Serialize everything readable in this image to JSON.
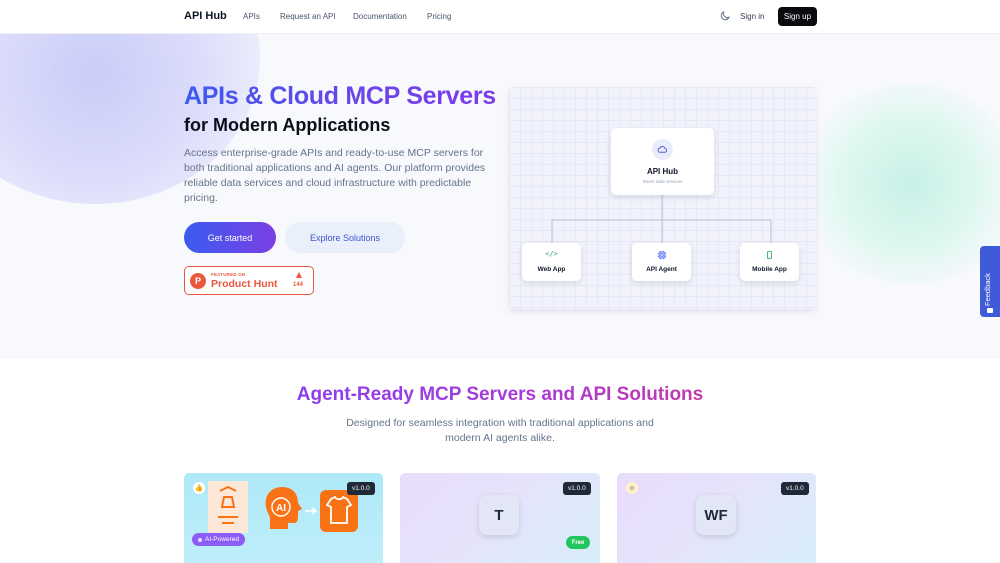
{
  "nav": {
    "brand": "API Hub",
    "links": [
      "APIs",
      "Request an API",
      "Documentation",
      "Pricing"
    ],
    "signin": "Sign in",
    "signup": "Sign up"
  },
  "hero": {
    "title_line1": "APIs & Cloud MCP Servers",
    "title_line2": "for Modern Applications",
    "description": "Access enterprise-grade APIs and ready-to-use MCP servers for both traditional applications and AI agents. Our platform provides reliable data services and cloud infrastructure with predictable pricing.",
    "primary_button": "Get started",
    "secondary_button": "Explore Solutions",
    "product_hunt": {
      "logo_letter": "P",
      "featured": "FEATURED ON",
      "name": "Product Hunt",
      "votes": "144"
    }
  },
  "diagram": {
    "hub_title": "API Hub",
    "hub_subtitle": "Smart data services",
    "nodes": [
      {
        "label": "Web App",
        "icon": "code-icon"
      },
      {
        "label": "API Agent",
        "icon": "chip-icon"
      },
      {
        "label": "Mobile App",
        "icon": "phone-icon"
      }
    ]
  },
  "feedback": "Feedback",
  "section": {
    "title": "Agent-Ready MCP Servers and API Solutions",
    "subtitle": "Designed for seamless integration with traditional applications and modern AI agents alike."
  },
  "cards": [
    {
      "version": "v1.0.0",
      "badge": "AI-Powered",
      "illustration_text": "AI"
    },
    {
      "version": "v1.0.0",
      "initials": "T",
      "badge": "Free"
    },
    {
      "version": "v1.0.0",
      "initials": "WF"
    }
  ],
  "colors": {
    "accent_blue": "#3b5bf0",
    "accent_purple": "#7c3aed",
    "product_hunt": "#e9573f",
    "free_green": "#22c55e",
    "feedback_blue": "#3f5bd8"
  }
}
